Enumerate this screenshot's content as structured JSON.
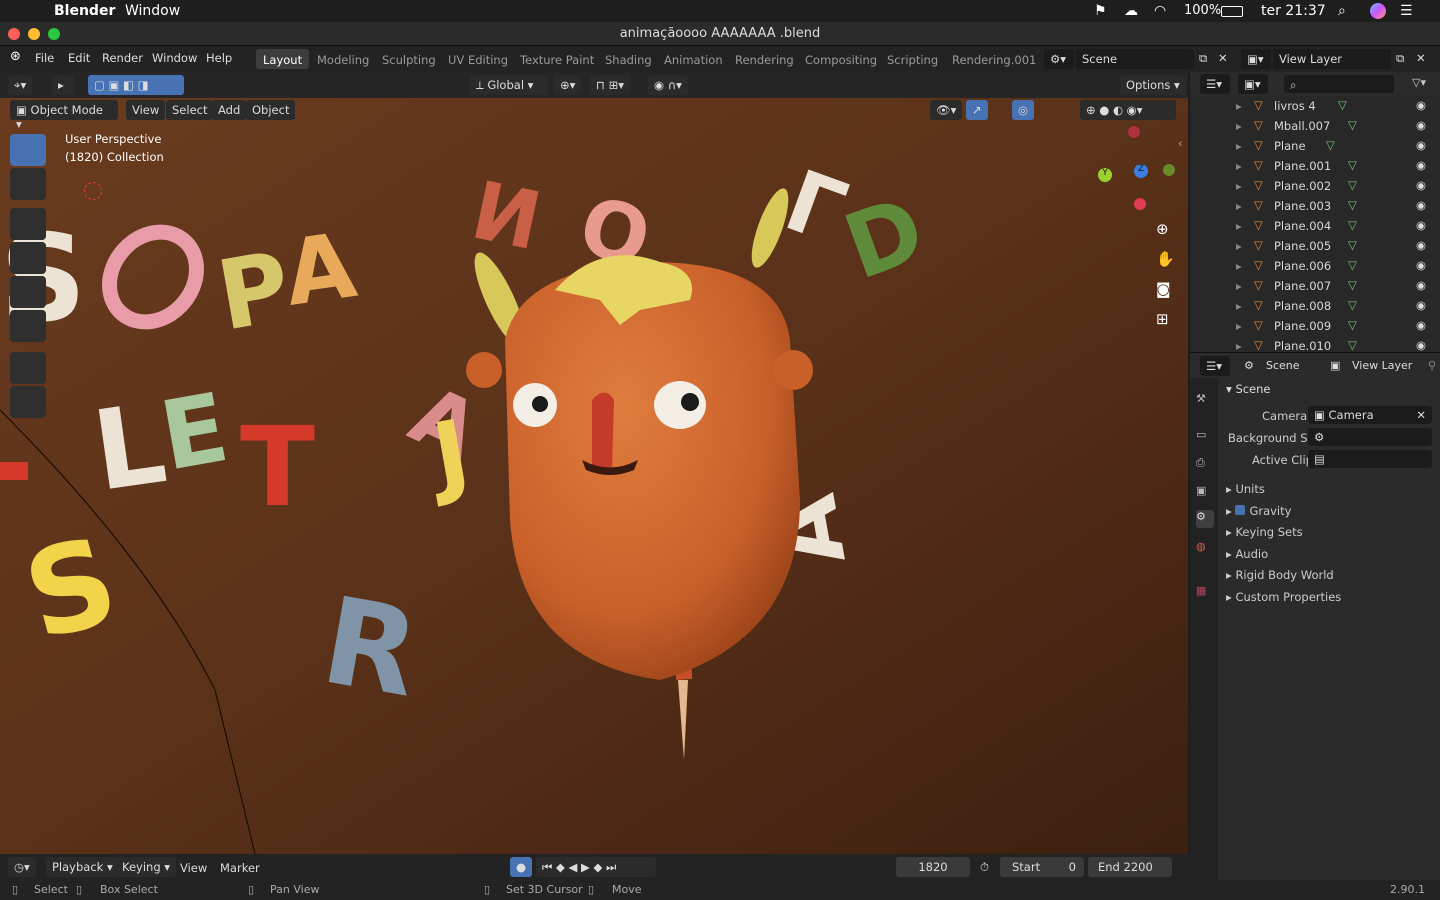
{
  "os_menu": {
    "app": "Blender",
    "window": "Window",
    "battery": "100%",
    "clock": "ter 21:37"
  },
  "window_title": "animaçãoooo AAAAAAA .blend",
  "menus": [
    "File",
    "Edit",
    "Render",
    "Window",
    "Help"
  ],
  "workspaces": [
    "Layout",
    "Modeling",
    "Sculpting",
    "UV Editing",
    "Texture Paint",
    "Shading",
    "Animation",
    "Rendering",
    "Compositing",
    "Scripting",
    "Rendering.001"
  ],
  "scene_field": "Scene",
  "view_layer_field": "View Layer",
  "header": {
    "transform_orientation": "Global",
    "options": "Options"
  },
  "viewport_header": {
    "mode": "Object Mode",
    "menus": [
      "View",
      "Select",
      "Add",
      "Object"
    ]
  },
  "viewport_overlay": {
    "perspective": "User Perspective",
    "collection": "(1820) Collection"
  },
  "gizmo": {
    "z": "Z",
    "y": "Y",
    "x": "X"
  },
  "outliner": {
    "items": [
      "livros 4",
      "Mball.007",
      "Plane",
      "Plane.001",
      "Plane.002",
      "Plane.003",
      "Plane.004",
      "Plane.005",
      "Plane.006",
      "Plane.007",
      "Plane.008",
      "Plane.009",
      "Plane.010"
    ]
  },
  "properties": {
    "breadcrumb_scene": "Scene",
    "breadcrumb_view_layer": "View Layer",
    "panel_title": "Scene",
    "camera_label": "Camera",
    "camera_value": "Camera",
    "background_label": "Background S...",
    "active_clip_label": "Active Clip",
    "subpanels": [
      "Units",
      "Gravity",
      "Keying Sets",
      "Audio",
      "Rigid Body World",
      "Custom Properties"
    ]
  },
  "timeline": {
    "playback": "Playback",
    "keying": "Keying",
    "view": "View",
    "marker": "Marker",
    "current_frame": "1820",
    "start_label": "Start",
    "start_value": "0",
    "end_label": "End",
    "end_value": "2200"
  },
  "statusbar": {
    "select": "Select",
    "box_select": "Box Select",
    "pan_view": "Pan View",
    "set_cursor": "Set 3D Cursor",
    "move": "Move",
    "version": "2.90.1"
  },
  "colors": {
    "accent": "#4772b3",
    "object_orange": "#e08a3a",
    "mesh_green": "#6fc36f"
  }
}
